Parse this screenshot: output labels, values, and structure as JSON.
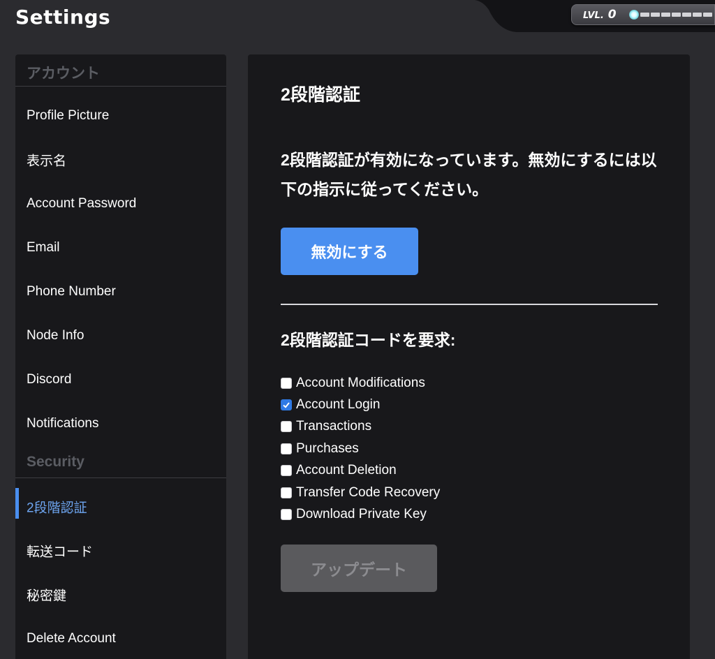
{
  "header": {
    "title": "Settings",
    "level_label": "LVL.",
    "level_value": "0",
    "level_progress": 0
  },
  "sidebar": {
    "sections": [
      {
        "title": "アカウント",
        "items": [
          {
            "label": "Profile Picture"
          },
          {
            "label": "表示名"
          },
          {
            "label": "Account Password"
          },
          {
            "label": "Email"
          },
          {
            "label": "Phone Number"
          },
          {
            "label": "Node Info"
          },
          {
            "label": "Discord"
          },
          {
            "label": "Notifications"
          }
        ]
      },
      {
        "title": "Security",
        "items": [
          {
            "label": "2段階認証",
            "active": true
          },
          {
            "label": "転送コード"
          },
          {
            "label": "秘密鍵"
          },
          {
            "label": "Delete Account"
          }
        ]
      }
    ]
  },
  "main": {
    "title": "2段階認証",
    "status_message": "2段階認証が有効になっています。無効にするには以下の指示に従ってください。",
    "disable_button": "無効にする",
    "require_title": "2段階認証コードを要求:",
    "options": [
      {
        "label": "Account Modifications",
        "checked": false
      },
      {
        "label": "Account Login",
        "checked": true
      },
      {
        "label": "Transactions",
        "checked": false
      },
      {
        "label": "Purchases",
        "checked": false
      },
      {
        "label": "Account Deletion",
        "checked": false
      },
      {
        "label": "Transfer Code Recovery",
        "checked": false
      },
      {
        "label": "Download Private Key",
        "checked": false
      }
    ],
    "update_button": "アップデート",
    "update_enabled": false
  },
  "colors": {
    "background": "#2b2b2f",
    "panel": "#18181b",
    "accent": "#4a8ff0",
    "disabled_button": "#5a5a5d"
  }
}
